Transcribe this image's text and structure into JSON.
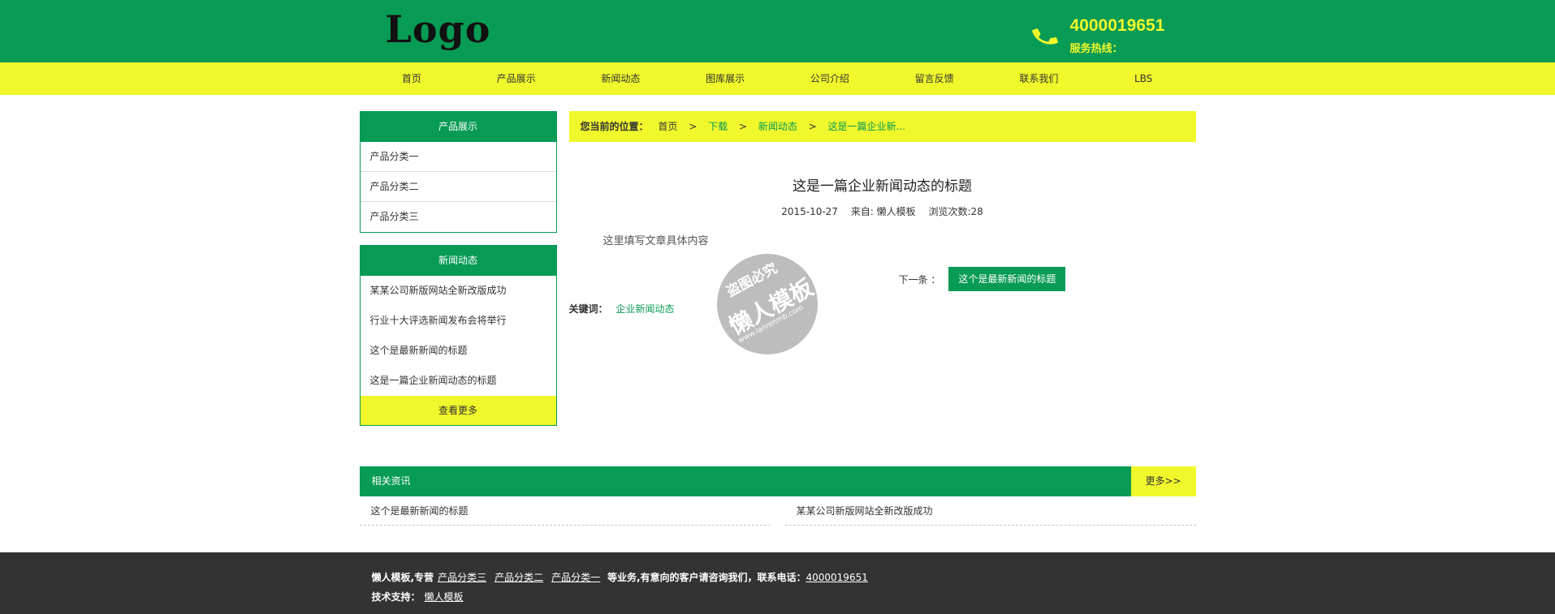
{
  "header": {
    "logo": "Logo",
    "hotline_number": "4000019651",
    "hotline_label": "服务热线："
  },
  "nav": [
    "首页",
    "产品展示",
    "新闻动态",
    "图库展示",
    "公司介绍",
    "留言反馈",
    "联系我们",
    "LBS"
  ],
  "sidebar_products": {
    "title": "产品展示",
    "items": [
      "产品分类一",
      "产品分类二",
      "产品分类三"
    ]
  },
  "sidebar_news": {
    "title": "新闻动态",
    "items": [
      "某某公司新版网站全新改版成功",
      "行业十大评选新闻发布会将举行",
      "这个是最新新闻的标题",
      "这是一篇企业新闻动态的标题"
    ],
    "more": "查看更多"
  },
  "breadcrumb": {
    "label": "您当前的位置：",
    "crumbs": [
      "首页",
      "下载",
      "新闻动态",
      "这是一篇企业新..."
    ],
    "sep": ">"
  },
  "article": {
    "title": "这是一篇企业新闻动态的标题",
    "date": "2015-10-27",
    "source": "来自: 懒人模板",
    "views": "浏览次数:28",
    "body": "这里填写文章具体内容",
    "next_label": "下一条 ：",
    "next_title": "这个是最新新闻的标题",
    "keywords_label": "关键词：",
    "keywords_value": "企业新闻动态"
  },
  "watermark": {
    "line1": "盗图必究",
    "line2": "懒人模板",
    "line3": "www.lanrenmb.com"
  },
  "related": {
    "title": "相关资讯",
    "more": "更多>>",
    "items": [
      "这个是最新新闻的标题",
      "某某公司新版网站全新改版成功"
    ]
  },
  "footer": {
    "prefix": "懒人模板,专营",
    "links": [
      "产品分类三",
      "产品分类二",
      "产品分类一"
    ],
    "suffix": "等业务,有意向的客户请咨询我们，联系电话：",
    "phone": "4000019651",
    "support_label": "技术支持：",
    "support_link": "懒人模板"
  }
}
